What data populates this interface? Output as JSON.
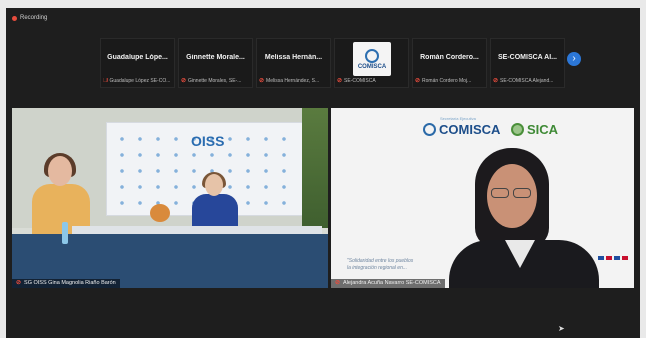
{
  "recording_label": "Recording",
  "participants": [
    {
      "display": "Guadalupe Lópe...",
      "label": "Guadalupe López SE-CO..."
    },
    {
      "display": "Ginnette Morale...",
      "label": "Ginnette Morales, SE-..."
    },
    {
      "display": "Melissa Hernán...",
      "label": "Melissa Hernández, S..."
    },
    {
      "display": "",
      "label": "SE-COMISCA",
      "logo_text": "COMISCA"
    },
    {
      "display": "Román Cordero...",
      "label": "Román Cordero Moj..."
    },
    {
      "display": "SE-COMISCA Al...",
      "label": "SE-COMISCA Alejand..."
    }
  ],
  "next_icon": "chevron-right-icon",
  "tiles": {
    "left": {
      "name": "SG OISS Gina Magnolia Riaño Barón",
      "backdrop_title": "OISS"
    },
    "right": {
      "name": "Alejandra Acuña Navarro SE-COMISCA",
      "logo1": "COMISCA",
      "logo1_small": "Secretaría Ejecutiva",
      "logo2": "SICA",
      "quote_line1": "\"Solidaridad entre los pueblos",
      "quote_line2": "la integración regional en..."
    }
  },
  "colors": {
    "accent": "#2c77d7",
    "mic_muted": "#e84c3d",
    "background": "#1e1e1e"
  }
}
